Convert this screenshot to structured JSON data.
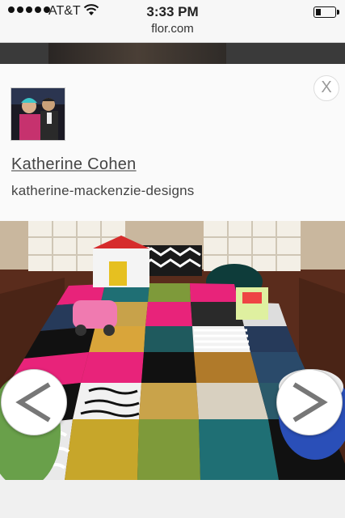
{
  "status_bar": {
    "carrier": "AT&T",
    "time": "3:33 PM",
    "url": "flor.com"
  },
  "lightbox": {
    "close_label": "X",
    "user_name": "Katherine Cohen",
    "user_handle": "katherine-mackenzie-designs"
  },
  "icons": {
    "prev": "chevron-left-icon",
    "next": "chevron-right-icon",
    "wifi": "wifi-icon",
    "battery": "battery-icon"
  },
  "colors": {
    "tile_pink": "#e8237a",
    "tile_green": "#7e9a3a",
    "tile_teal": "#1f6f74",
    "tile_navy": "#263a5a",
    "floor_wood": "#5a2c1c"
  }
}
